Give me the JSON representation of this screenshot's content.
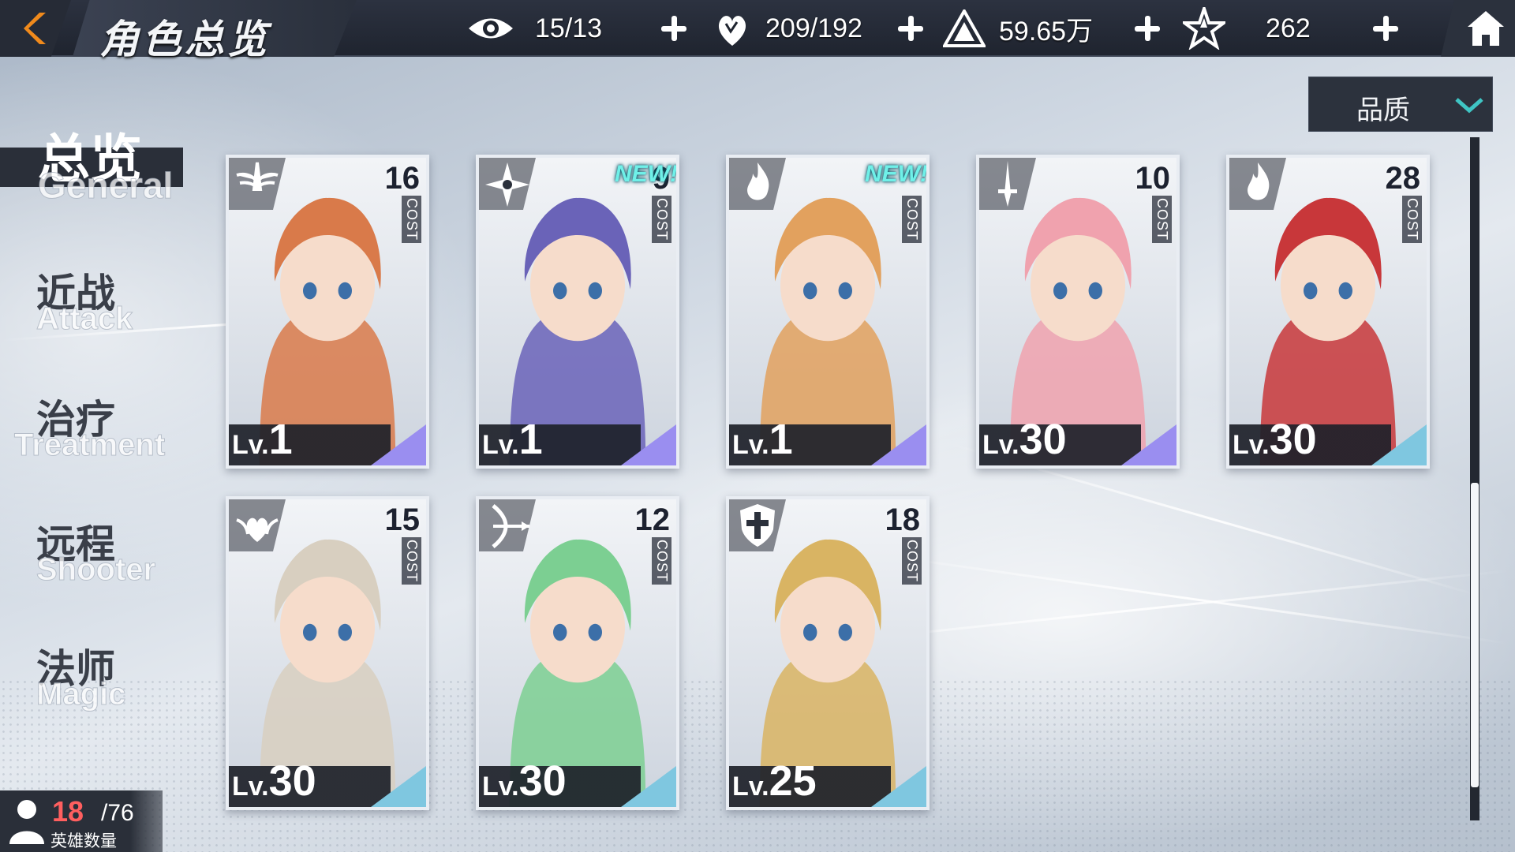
{
  "header": {
    "title": "角色总览",
    "resources": [
      {
        "name": "vision",
        "icon": "eye-icon",
        "value": "15/13"
      },
      {
        "name": "stamina",
        "icon": "heart-hand-icon",
        "value": "209/192"
      },
      {
        "name": "gold",
        "icon": "pyramid-icon",
        "value": "59.65万"
      },
      {
        "name": "crystal",
        "icon": "star-crystal-icon",
        "value": "262"
      }
    ]
  },
  "sort": {
    "label": "品质"
  },
  "sidebar": {
    "tabs": [
      {
        "cn": "总览",
        "en": "General",
        "active": true
      },
      {
        "cn": "近战",
        "en": "Attack",
        "active": false
      },
      {
        "cn": "治疗",
        "en": "Treatment",
        "active": false
      },
      {
        "cn": "远程",
        "en": "Shooter",
        "active": false
      },
      {
        "cn": "法师",
        "en": "Magic",
        "active": false
      }
    ]
  },
  "cards": [
    {
      "cost": "16",
      "cost_label": "COST",
      "lv_prefix": "Lv.",
      "level": "1",
      "class_icon": "winged-sword-icon",
      "new": false,
      "new_label": "",
      "rarity": "#9a8ef0",
      "art": "#d97a4a"
    },
    {
      "cost": "9",
      "cost_label": "COST",
      "lv_prefix": "Lv.",
      "level": "1",
      "class_icon": "shuriken-icon",
      "new": true,
      "new_label": "NEW!",
      "rarity": "#9a8ef0",
      "art": "#6a63b8"
    },
    {
      "cost": "",
      "cost_label": "COST",
      "lv_prefix": "Lv.",
      "level": "1",
      "class_icon": "flame-icon",
      "new": true,
      "new_label": "NEW!",
      "rarity": "#9a8ef0",
      "art": "#e2a15e"
    },
    {
      "cost": "10",
      "cost_label": "COST",
      "lv_prefix": "Lv.",
      "level": "30",
      "class_icon": "dagger-icon",
      "new": false,
      "new_label": "",
      "rarity": "#9a8ef0",
      "art": "#f0a2ae"
    },
    {
      "cost": "28",
      "cost_label": "COST",
      "lv_prefix": "Lv.",
      "level": "30",
      "class_icon": "flame-icon",
      "new": false,
      "new_label": "",
      "rarity": "#7fc7e0",
      "art": "#c8373a"
    },
    {
      "cost": "15",
      "cost_label": "COST",
      "lv_prefix": "Lv.",
      "level": "30",
      "class_icon": "heart-wing-icon",
      "new": false,
      "new_label": "",
      "rarity": "#7fc7e0",
      "art": "#d8cfc0"
    },
    {
      "cost": "12",
      "cost_label": "COST",
      "lv_prefix": "Lv.",
      "level": "30",
      "class_icon": "bow-icon",
      "new": false,
      "new_label": "",
      "rarity": "#7fc7e0",
      "art": "#7ccf92"
    },
    {
      "cost": "18",
      "cost_label": "COST",
      "lv_prefix": "Lv.",
      "level": "25",
      "class_icon": "shield-cross-icon",
      "new": false,
      "new_label": "",
      "rarity": "#7fc7e0",
      "art": "#d9b463"
    }
  ],
  "hero_count": {
    "current": "18",
    "max": "/76",
    "label": "英雄数量"
  },
  "colors": {
    "bar": "#1f242f",
    "accent": "#f08a1c",
    "dropdown_chevron": "#3fc5c4",
    "hero_count_current": "#ff5f5f"
  }
}
